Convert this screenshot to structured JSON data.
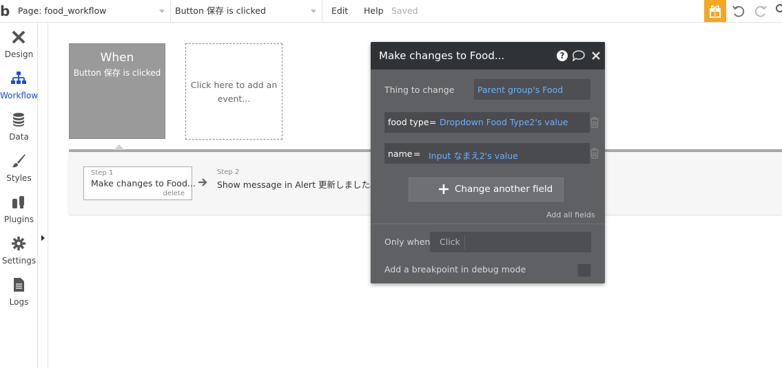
{
  "topbar": {
    "logo_text": "b",
    "page_select": "Page: food_workflow",
    "event_select": "Button 保存 is clicked",
    "edit_label": "Edit",
    "help_label": "Help",
    "saved_label": "Saved"
  },
  "sidebar": {
    "items": [
      {
        "label": "Design",
        "icon": "design-icon"
      },
      {
        "label": "Workflow",
        "icon": "workflow-icon"
      },
      {
        "label": "Data",
        "icon": "database-icon"
      },
      {
        "label": "Styles",
        "icon": "brush-icon"
      },
      {
        "label": "Plugins",
        "icon": "plugin-icon"
      },
      {
        "label": "Settings",
        "icon": "gear-icon"
      },
      {
        "label": "Logs",
        "icon": "document-icon"
      }
    ]
  },
  "workflow": {
    "when_title": "When",
    "when_subtitle": "Button 保存 is clicked",
    "add_event_line1": "Click here to add an",
    "add_event_line2": "event...",
    "step1_number": "Step 1",
    "step1_label": "Make changes to Food...",
    "step1_delete": "delete",
    "step2_number": "Step 2",
    "step2_label": "Show message in Alert 更新しました。"
  },
  "panel": {
    "title": "Make changes to Food...",
    "help_glyph": "?",
    "thing_label": "Thing to change",
    "thing_value": "Parent group's Food",
    "fields": [
      {
        "key": "food type",
        "op": "=",
        "value": "Dropdown Food Type2's value"
      },
      {
        "key": "name",
        "op": "=",
        "value": "Input なまえ2's value"
      }
    ],
    "change_button": "Change another field",
    "add_all": "Add all fields",
    "only_when_label": "Only when",
    "only_when_value": "Click",
    "breakpoint_label": "Add a breakpoint in debug mode"
  },
  "colors": {
    "accent_orange": "#f5a623",
    "workflow_active": "#1a4bd6",
    "link_blue": "#6ab0ff",
    "panel_bg": "#5f6063",
    "panel_header": "#2f3336"
  }
}
